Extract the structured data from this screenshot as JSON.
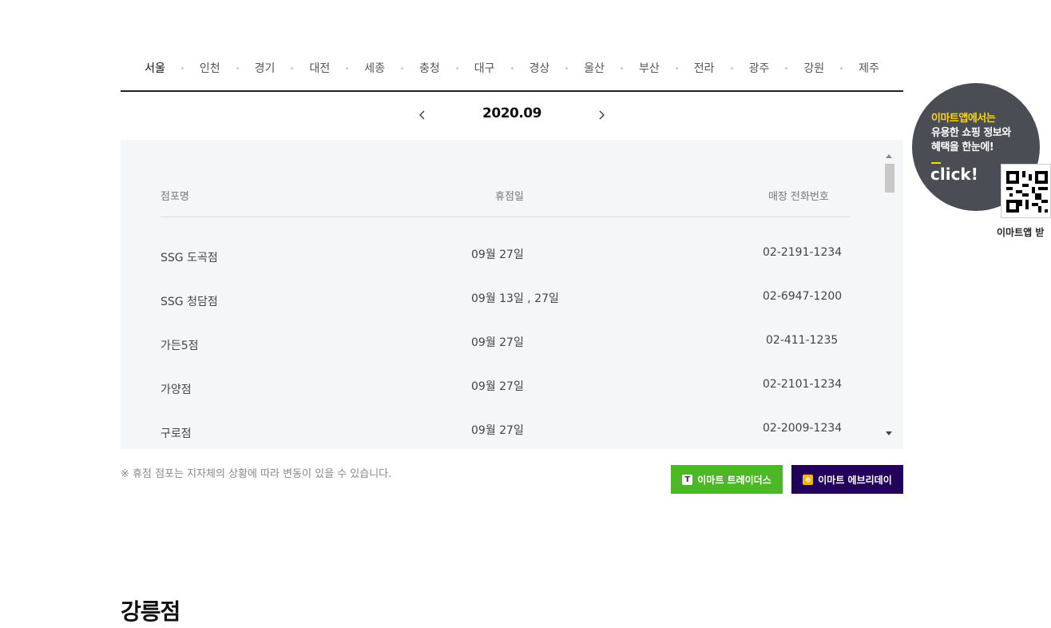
{
  "regions": [
    "서울",
    "인천",
    "경기",
    "대전",
    "세종",
    "충청",
    "대구",
    "경상",
    "울산",
    "부산",
    "전라",
    "광주",
    "강원",
    "제주"
  ],
  "active_region": "서울",
  "month_nav": {
    "current": "2020.09",
    "prev_icon": "chevron-left-icon",
    "next_icon": "chevron-right-icon"
  },
  "table": {
    "headers": {
      "name": "점포명",
      "date": "휴점일",
      "phone": "매장 전화번호"
    },
    "rows": [
      {
        "name": "SSG 도곡점",
        "date": "09월 27일",
        "phone": "02-2191-1234"
      },
      {
        "name": "SSG 청담점",
        "date": "09월 13일 , 27일",
        "phone": "02-6947-1200"
      },
      {
        "name": "가든5점",
        "date": "09월 27일",
        "phone": "02-411-1235"
      },
      {
        "name": "가양점",
        "date": "09월 27일",
        "phone": "02-2101-1234"
      },
      {
        "name": "구로점",
        "date": "09월 27일",
        "phone": "02-2009-1234"
      }
    ]
  },
  "notice": "※ 휴점 점포는 지자체의 상황에 따라 변동이 있을 수 있습니다.",
  "buttons": {
    "traders": {
      "label": "이마트 트레이더스",
      "icon_text": "T"
    },
    "everyday": {
      "label": "이마트 에브리데이",
      "icon_text": "e"
    }
  },
  "store_title": "강릉점",
  "promo": {
    "line1": "이마트앱에서는",
    "line2": "유용한 쇼핑 정보와",
    "line3": "혜택을 한눈에!",
    "click": "click!",
    "qr_caption": "이마트앱 받"
  },
  "colors": {
    "traders": "#4cb826",
    "everyday": "#22005a",
    "promo_bg": "#4a4d54",
    "promo_accent": "#ffd800"
  }
}
